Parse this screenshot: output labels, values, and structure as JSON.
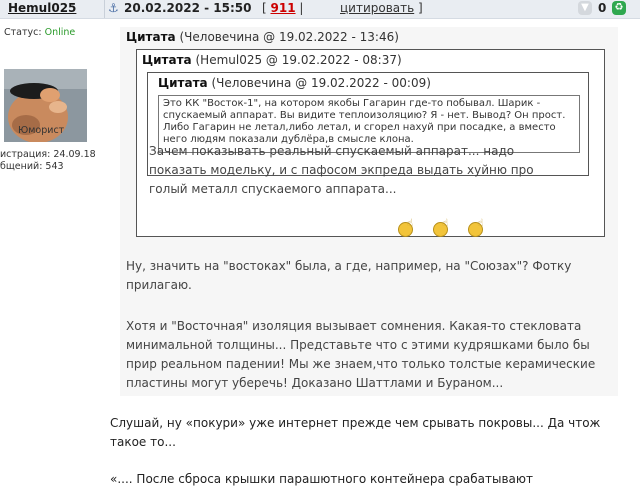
{
  "post": {
    "author": "Hemul025",
    "date": "20.02.2022 - 15:50",
    "number": "911",
    "cite_label": "цитировать",
    "vote_count": "0"
  },
  "user": {
    "status_label": "Статус:",
    "status_value": "Online",
    "rank": "Юморист",
    "registered": "истрация: 24.09.18",
    "posts": "бщений: 543"
  },
  "quotes": {
    "q1_label": "Цитата",
    "q1_meta": "(Человечина @ 19.02.2022 - 13:46)",
    "q2_label": "Цитата",
    "q2_meta": "(Hemul025 @ 19.02.2022 - 08:37)",
    "q3_label": "Цитата",
    "q3_meta": "(Человечина @ 19.02.2022 - 00:09)",
    "q4_text": "Это КК \"Восток-1\", на котором якобы Гагарин где-то побывал. Шарик - спускаемый аппарат. Вы видите теплоизоляцию? Я - нет. Вывод? Он прост. Либо Гагарин не летал,либо летал, и сгорел нахуй при посадке, а вместо него людям показали дублёра,в смысле клона.",
    "q3_text": "Зачем показывать реальный спускаемый аппарат... надо показать модельку, и с пафосом экпреда выдать хуйню про голый металл спускаемого аппарата...",
    "q2_p1": "Ну, значить на \"востоках\" была, а где, например, на \"Союзах\"? Фотку прилагаю.",
    "q2_p2": "Хотя и \"Восточная\" изоляция вызывает сомнения. Какая-то стекловата минимальной толщины... Представьте что с этими кудряшками было бы прир реальном падении! Мы же знаем,что только толстые керамические пластины могут уберечь! Доказано Шаттлами и Бураном..."
  },
  "body": {
    "p1": "Слушай, ну «покури» уже интернет прежде чем срывать покровы... Да чтож такое то...",
    "p2": "«.... После сброса крышки парашютного контейнера срабатывают"
  },
  "colors": {
    "header_bg": "#e9edf2",
    "online": "#2a9a2a",
    "post_number": "#cc0000",
    "vote_up": "#2fa84f"
  }
}
